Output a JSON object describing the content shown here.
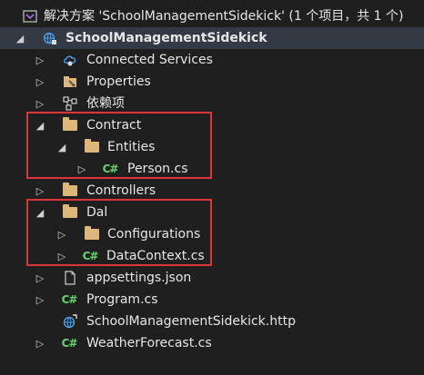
{
  "solution": {
    "label": "解决方案 'SchoolManagementSidekick' (1 个项目，共 1 个)"
  },
  "project": {
    "label": "SchoolManagementSidekick"
  },
  "items": {
    "connected_services": "Connected Services",
    "properties": "Properties",
    "dependencies": "依赖项",
    "contract": "Contract",
    "entities": "Entities",
    "person": "Person.cs",
    "controllers": "Controllers",
    "dal": "Dal",
    "configurations": "Configurations",
    "datacontext": "DataContext.cs",
    "appsettings": "appsettings.json",
    "program": "Program.cs",
    "http": "SchoolManagementSidekick.http",
    "weather": "WeatherForecast.cs"
  },
  "icons": {
    "csharp_glyph": "C#",
    "colors": {
      "folder": "#dcb67a",
      "csharp": "#65d46e",
      "highlight": "#e0353a",
      "selection": "#333a44"
    }
  }
}
